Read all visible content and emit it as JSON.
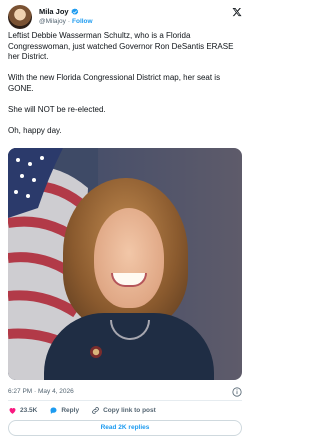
{
  "author": {
    "display_name": "Mila Joy",
    "handle": "@Milajoy",
    "separator": "·",
    "follow_label": "Follow"
  },
  "tweet": {
    "paragraphs": [
      "Leftist Debbie Wasserman Schultz, who is a Florida Congresswoman, just watched Governor Ron DeSantis ERASE her District.",
      "With the new Florida Congressional District map, her seat is GONE.",
      "She will NOT be re-elected.",
      "Oh, happy day."
    ],
    "timestamp": "6:27 PM · May 4, 2026"
  },
  "actions": {
    "like_count": "23.5K",
    "reply_label": "Reply",
    "copy_label": "Copy link to post"
  },
  "read_replies_label": "Read 2K replies",
  "colors": {
    "accent": "#1d9bf0",
    "like": "#f91880",
    "text": "#0f1419",
    "muted": "#536471"
  },
  "icons": [
    "verified-badge-icon",
    "x-logo-icon",
    "info-icon",
    "heart-icon",
    "reply-icon",
    "link-icon"
  ]
}
